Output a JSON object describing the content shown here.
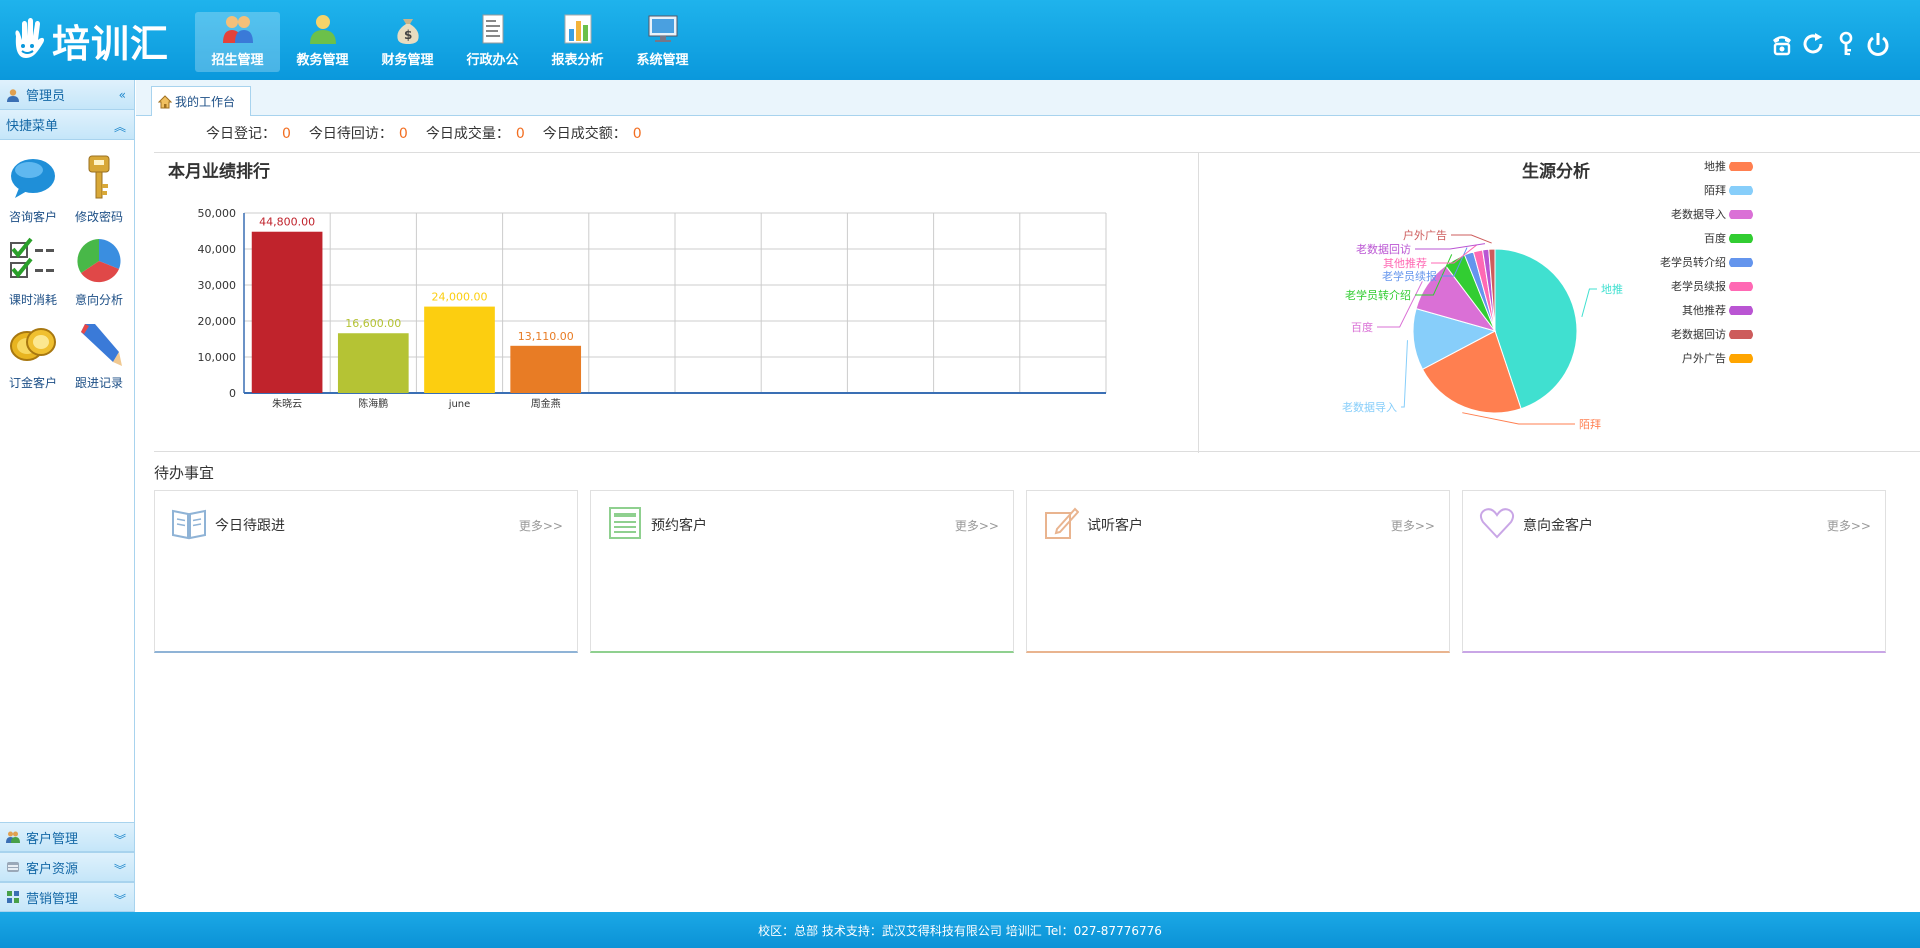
{
  "header": {
    "logo_text": "培训汇",
    "nav": [
      {
        "label": "招生管理",
        "active": true
      },
      {
        "label": "教务管理"
      },
      {
        "label": "财务管理"
      },
      {
        "label": "行政办公"
      },
      {
        "label": "报表分析"
      },
      {
        "label": "系统管理"
      }
    ]
  },
  "sidebar": {
    "user_label": "管理员",
    "quick_menu_label": "快捷菜单",
    "quick_items": [
      {
        "label": "咨询客户",
        "icon": "chat-bubble-icon"
      },
      {
        "label": "修改密码",
        "icon": "key-icon"
      },
      {
        "label": "课时消耗",
        "icon": "checklist-icon"
      },
      {
        "label": "意向分析",
        "icon": "pie-chart-icon"
      },
      {
        "label": "订金客户",
        "icon": "coins-icon"
      },
      {
        "label": "跟进记录",
        "icon": "pencil-icon"
      }
    ],
    "bottom_sections": [
      {
        "label": "客户管理"
      },
      {
        "label": "客户资源"
      },
      {
        "label": "营销管理"
      }
    ]
  },
  "tabs": [
    {
      "label": "我的工作台"
    }
  ],
  "stats": [
    {
      "label": "今日登记：",
      "value": "0"
    },
    {
      "label": "今日待回访：",
      "value": "0"
    },
    {
      "label": "今日成交量：",
      "value": "0"
    },
    {
      "label": "今日成交额：",
      "value": "0"
    }
  ],
  "bar_panel": {
    "title": "本月业绩排行"
  },
  "pie_panel": {
    "title": "生源分析"
  },
  "todo": {
    "title": "待办事宜",
    "more_label": "更多>>",
    "cards": [
      {
        "title": "今日待跟进",
        "color": "#8fb3d6"
      },
      {
        "title": "预约客户",
        "color": "#8fd08f"
      },
      {
        "title": "试听客户",
        "color": "#e9b48f"
      },
      {
        "title": "意向金客户",
        "color": "#c9a6e6"
      }
    ]
  },
  "footer": {
    "text": "校区：总部 技术支持：武汉艾得科技有限公司 培训汇 Tel：027-87776776"
  },
  "chart_data": [
    {
      "type": "bar",
      "categories": [
        "朱晓云",
        "陈海鹏",
        "june",
        "周金燕"
      ],
      "values": [
        44800,
        16600,
        24000,
        13110
      ],
      "value_labels": [
        "44,800.00",
        "16,600.00",
        "24,000.00",
        "13,110.00"
      ],
      "colors": [
        "#c0232c",
        "#b5c334",
        "#fcce10",
        "#e87c25"
      ],
      "ylim": [
        0,
        50000
      ],
      "yticks": [
        "0",
        "10,000",
        "20,000",
        "30,000",
        "40,000",
        "50,000"
      ],
      "slots": 10,
      "grid": true
    },
    {
      "type": "pie",
      "labels": [
        "地推",
        "陌拜",
        "老数据导入",
        "百度",
        "老学员转介绍",
        "老学员续报",
        "其他推荐",
        "老数据回访",
        "户外广告"
      ],
      "values": [
        37,
        18.5,
        10,
        8.5,
        3.5,
        1.5,
        1.5,
        1,
        1
      ],
      "colors": [
        "#40e0d0",
        "#ff7f50",
        "#87cefa",
        "#da70d6",
        "#32cd32",
        "#6495ed",
        "#ff69b4",
        "#ba55d3",
        "#cd5c5c",
        "#ffa500"
      ],
      "legend": [
        "地推",
        "陌拜",
        "老数据导入",
        "百度",
        "老学员转介绍",
        "老学员续报",
        "其他推荐",
        "老数据回访",
        "户外广告"
      ],
      "legend_colors": [
        "#ff7f50",
        "#87cefa",
        "#da70d6",
        "#32cd32",
        "#6495ed",
        "#ff69b4",
        "#ba55d3",
        "#cd5c5c",
        "#ffa500"
      ],
      "legend_position": "right"
    }
  ]
}
